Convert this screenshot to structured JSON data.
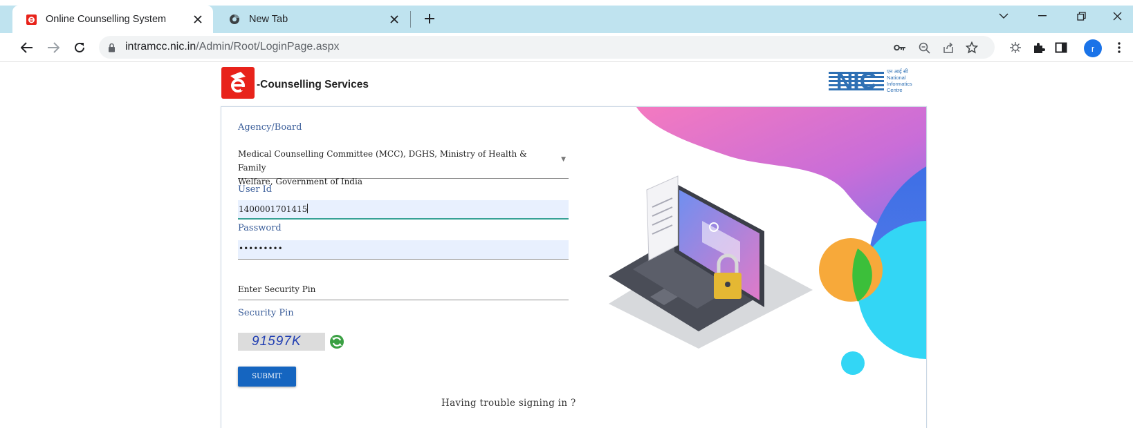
{
  "browser": {
    "tabs": [
      {
        "title": "Online Counselling System",
        "active": true
      },
      {
        "title": "New Tab",
        "active": false
      }
    ],
    "url_host": "intramcc.nic.in",
    "url_path": "/Admin/Root/LoginPage.aspx",
    "profile_initial": "r",
    "accent_color": "#1a73e8",
    "tabstrip_color": "#bfe3ef"
  },
  "header": {
    "logo_letter": "e",
    "brand_name": "-Counselling Services",
    "nic_logo_text": "NIC",
    "nic_hindi": "एन आई सी",
    "nic_line1": "National",
    "nic_line2": "Informatics",
    "nic_line3": "Centre"
  },
  "form": {
    "agency_label": "Agency/Board",
    "agency_line1": "Medical Counselling Committee (MCC), DGHS, Ministry of Health & Family",
    "agency_line2": "Welfare, Government of India",
    "userid_label": "User Id",
    "userid_value": "1400001701415",
    "password_label": "Password",
    "password_value": "•••••••••",
    "pin_entry_placeholder": "Enter Security Pin",
    "security_pin_label": "Security Pin",
    "captcha_text": "91597K",
    "submit_label": "SUBMIT",
    "trouble_link": "Having trouble signing in ?"
  }
}
